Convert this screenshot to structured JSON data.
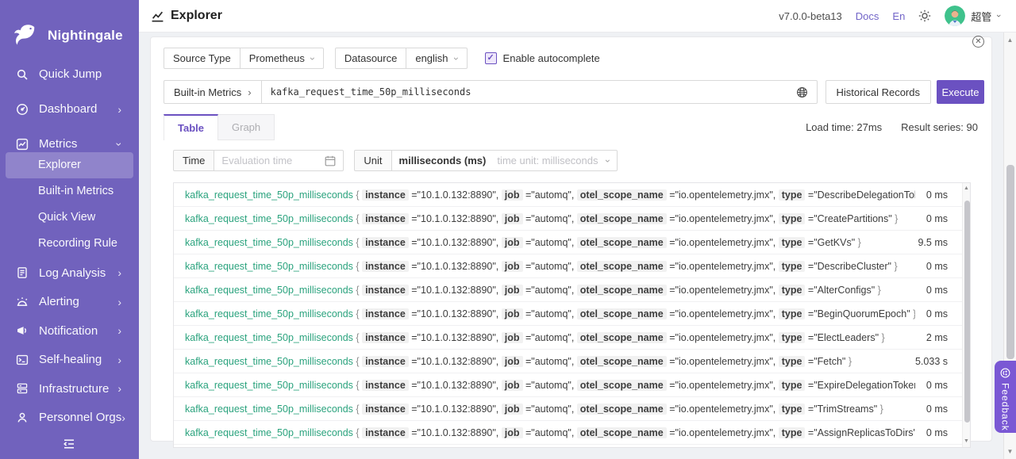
{
  "theme": {
    "sidebar_bg": "#7162bd",
    "accent": "#6b51c1",
    "metric_color": "#2ba37e",
    "avatar_bg": "#3fc28c"
  },
  "sidebar": {
    "logo_text": "Nightingale",
    "items": [
      {
        "label": "Quick Jump",
        "icon": "search"
      },
      {
        "label": "Dashboard",
        "icon": "dashboard",
        "chevron": "right"
      },
      {
        "label": "Metrics",
        "icon": "metrics",
        "chevron": "down",
        "children": [
          {
            "label": "Explorer",
            "active": true
          },
          {
            "label": "Built-in Metrics"
          },
          {
            "label": "Quick View"
          },
          {
            "label": "Recording Rule"
          }
        ]
      },
      {
        "label": "Log Analysis",
        "icon": "log",
        "chevron": "right"
      },
      {
        "label": "Alerting",
        "icon": "alert",
        "chevron": "right"
      },
      {
        "label": "Notification",
        "icon": "megaphone",
        "chevron": "right"
      },
      {
        "label": "Self-healing",
        "icon": "terminal",
        "chevron": "right"
      },
      {
        "label": "Infrastructure",
        "icon": "infrastructure",
        "chevron": "right"
      },
      {
        "label": "Personnel Orgs",
        "icon": "person",
        "chevron": "right"
      }
    ]
  },
  "topbar": {
    "title": "Explorer",
    "version": "v7.0.0-beta13",
    "docs_link": "Docs",
    "lang_link": "En",
    "username": "超管"
  },
  "controls": {
    "source_type_label": "Source Type",
    "source_type_value": "Prometheus",
    "datasource_label": "Datasource",
    "datasource_value": "english",
    "autocomplete_label": "Enable autocomplete",
    "checkbox_checked": "✓"
  },
  "query": {
    "addon_label": "Built-in Metrics",
    "value": "kafka_request_time_50p_milliseconds",
    "historical_button": "Historical Records",
    "execute_button": "Execute"
  },
  "tabs": [
    {
      "label": "Table",
      "active": true
    },
    {
      "label": "Graph",
      "active": false
    }
  ],
  "stats": {
    "load_time": "Load time: 27ms",
    "result_series": "Result series: 90"
  },
  "filters": {
    "time_label": "Time",
    "time_placeholder": "Evaluation time",
    "unit_label": "Unit",
    "unit_value": "milliseconds (ms)",
    "unit_hint": "time unit: milliseconds"
  },
  "results": {
    "metric": "kafka_request_time_50p_milliseconds",
    "common_labels": [
      {
        "key": "instance",
        "value": "10.1.0.132:8890"
      },
      {
        "key": "job",
        "value": "automq"
      },
      {
        "key": "otel_scope_name",
        "value": "io.opentelemetry.jmx"
      }
    ],
    "rows": [
      {
        "type": "DescribeDelegationToken",
        "value": "0 ms"
      },
      {
        "type": "CreatePartitions",
        "value": "0 ms"
      },
      {
        "type": "GetKVs",
        "value": "9.5 ms"
      },
      {
        "type": "DescribeCluster",
        "value": "0 ms"
      },
      {
        "type": "AlterConfigs",
        "value": "0 ms"
      },
      {
        "type": "BeginQuorumEpoch",
        "value": "0 ms"
      },
      {
        "type": "ElectLeaders",
        "value": "2 ms"
      },
      {
        "type": "Fetch",
        "value": "5.033 s"
      },
      {
        "type": "ExpireDelegationToken",
        "value": "0 ms"
      },
      {
        "type": "TrimStreams",
        "value": "0 ms"
      },
      {
        "type": "AssignReplicasToDirs",
        "value": "0 ms"
      }
    ]
  },
  "feedback_label": "Feedback"
}
